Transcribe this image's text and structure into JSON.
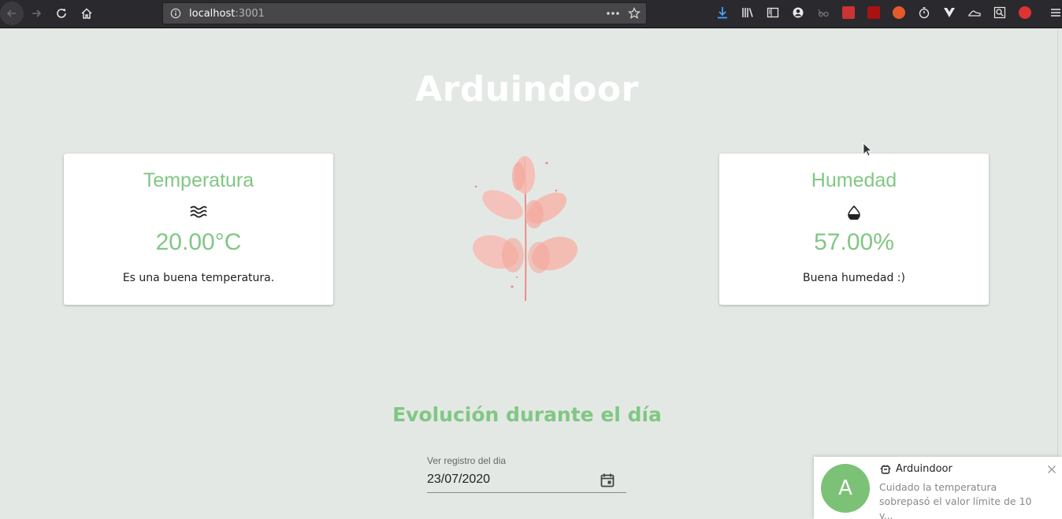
{
  "browser": {
    "url_host": "localhost",
    "url_port": ":3001",
    "icons": {
      "back": "back-arrow-icon",
      "forward": "forward-arrow-icon",
      "reload": "reload-icon",
      "home": "home-icon",
      "info": "info-icon",
      "more": "more-dots-icon",
      "bookmark": "star-icon",
      "download": "download-icon",
      "library": "library-icon",
      "sidebar": "sidebar-icon",
      "account": "account-icon",
      "menu": "hamburger-menu-icon"
    },
    "extension_colors": [
      "#c33",
      "#a11",
      "#e55a2b",
      "#d33"
    ]
  },
  "page": {
    "title": "Arduindoor",
    "section_title": "Evolución durante el día"
  },
  "temperature": {
    "title": "Temperatura",
    "icon": "waves-icon",
    "value": "20.00°C",
    "message": "Es una buena temperatura."
  },
  "humidity": {
    "title": "Humedad",
    "icon": "water-drop-icon",
    "value": "57.00%",
    "message": "Buena humedad :)"
  },
  "date_picker": {
    "label": "Ver registro del dia",
    "value": "23/07/2020",
    "icon": "calendar-icon"
  },
  "notification": {
    "avatar_letter": "A",
    "app_name": "Arduindoor",
    "body": "Cuidado la temperatura\nsobrepasó el valor límite de 10 y..."
  },
  "colors": {
    "accent": "#81c784",
    "background": "#e4e8e5",
    "card": "#ffffff",
    "avatar": "#7cc276",
    "plant": "#f4a69b"
  }
}
